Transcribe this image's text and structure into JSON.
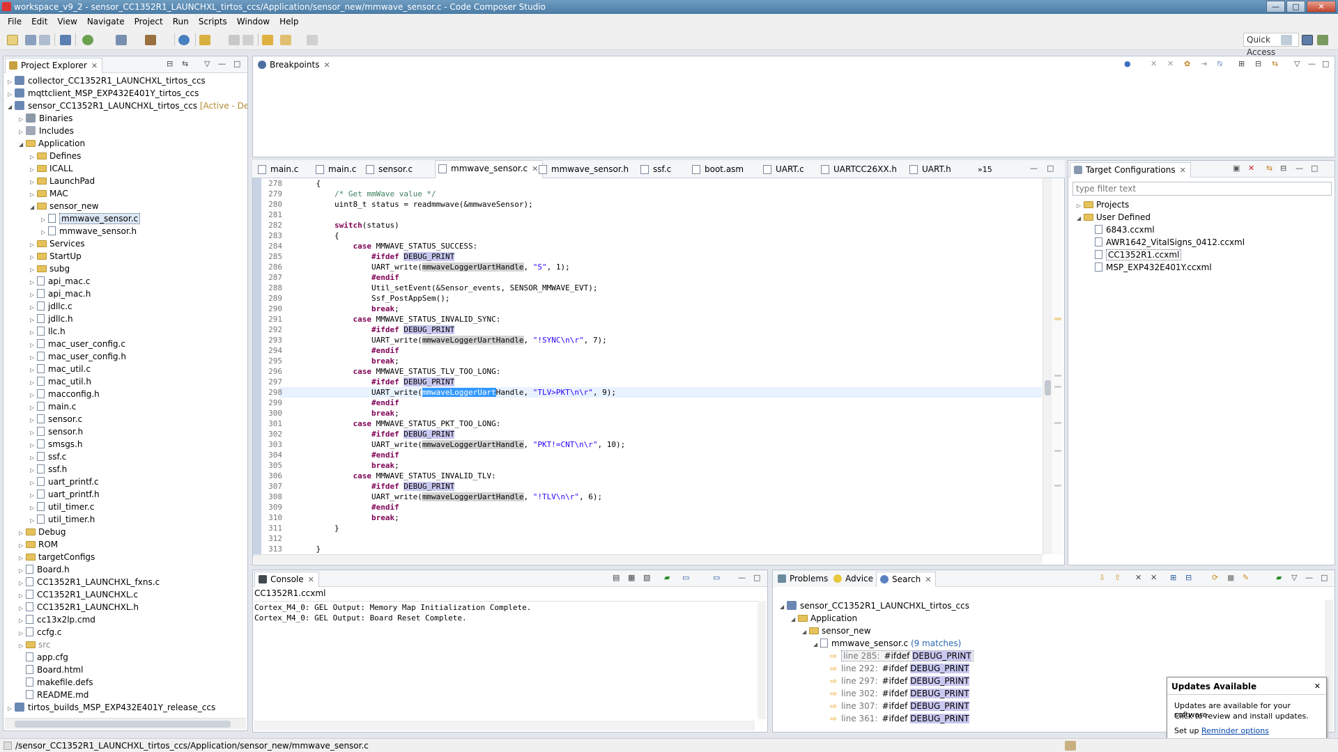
{
  "window": {
    "title": "workspace_v9_2 - sensor_CC1352R1_LAUNCHXL_tirtos_ccs/Application/sensor_new/mmwave_sensor.c - Code Composer Studio",
    "min": "—",
    "max": "□",
    "close": "✕"
  },
  "menu": [
    "File",
    "Edit",
    "View",
    "Navigate",
    "Project",
    "Run",
    "Scripts",
    "Window",
    "Help"
  ],
  "toolbar": {
    "quick_access": "Quick Access"
  },
  "project_explorer": {
    "tab": "Project Explorer",
    "items": [
      {
        "indent": 0,
        "tw": "▷",
        "icon": "proj",
        "label": "collector_CC1352R1_LAUNCHXL_tirtos_ccs"
      },
      {
        "indent": 0,
        "tw": "▷",
        "icon": "proj",
        "label": "mqttclient_MSP_EXP432E401Y_tirtos_ccs"
      },
      {
        "indent": 0,
        "tw": "◢",
        "icon": "proj",
        "label": "sensor_CC1352R1_LAUNCHXL_tirtos_ccs",
        "suffix": "[Active - Deb"
      },
      {
        "indent": 1,
        "tw": "▷",
        "icon": "bin",
        "label": "Binaries"
      },
      {
        "indent": 1,
        "tw": "▷",
        "icon": "inc",
        "label": "Includes"
      },
      {
        "indent": 1,
        "tw": "◢",
        "icon": "folder",
        "label": "Application"
      },
      {
        "indent": 2,
        "tw": "▷",
        "icon": "folder",
        "label": "Defines"
      },
      {
        "indent": 2,
        "tw": "▷",
        "icon": "folder",
        "label": "ICALL"
      },
      {
        "indent": 2,
        "tw": "▷",
        "icon": "folder",
        "label": "LaunchPad"
      },
      {
        "indent": 2,
        "tw": "▷",
        "icon": "folder",
        "label": "MAC"
      },
      {
        "indent": 2,
        "tw": "◢",
        "icon": "folder",
        "label": "sensor_new"
      },
      {
        "indent": 3,
        "tw": "▷",
        "icon": "file",
        "label": "mmwave_sensor.c",
        "selected": true
      },
      {
        "indent": 3,
        "tw": "▷",
        "icon": "file",
        "label": "mmwave_sensor.h"
      },
      {
        "indent": 2,
        "tw": "▷",
        "icon": "folder",
        "label": "Services"
      },
      {
        "indent": 2,
        "tw": "▷",
        "icon": "folder",
        "label": "StartUp"
      },
      {
        "indent": 2,
        "tw": "▷",
        "icon": "folder",
        "label": "subg"
      },
      {
        "indent": 2,
        "tw": "▷",
        "icon": "file",
        "label": "api_mac.c"
      },
      {
        "indent": 2,
        "tw": "▷",
        "icon": "file",
        "label": "api_mac.h"
      },
      {
        "indent": 2,
        "tw": "▷",
        "icon": "file",
        "label": "jdllc.c"
      },
      {
        "indent": 2,
        "tw": "▷",
        "icon": "file",
        "label": "jdllc.h"
      },
      {
        "indent": 2,
        "tw": "▷",
        "icon": "file",
        "label": "llc.h"
      },
      {
        "indent": 2,
        "tw": "▷",
        "icon": "file",
        "label": "mac_user_config.c"
      },
      {
        "indent": 2,
        "tw": "▷",
        "icon": "file",
        "label": "mac_user_config.h"
      },
      {
        "indent": 2,
        "tw": "▷",
        "icon": "file",
        "label": "mac_util.c"
      },
      {
        "indent": 2,
        "tw": "▷",
        "icon": "file",
        "label": "mac_util.h"
      },
      {
        "indent": 2,
        "tw": "▷",
        "icon": "file",
        "label": "macconfig.h"
      },
      {
        "indent": 2,
        "tw": "▷",
        "icon": "file",
        "label": "main.c"
      },
      {
        "indent": 2,
        "tw": "▷",
        "icon": "file",
        "label": "sensor.c"
      },
      {
        "indent": 2,
        "tw": "▷",
        "icon": "file",
        "label": "sensor.h"
      },
      {
        "indent": 2,
        "tw": "▷",
        "icon": "file",
        "label": "smsgs.h"
      },
      {
        "indent": 2,
        "tw": "▷",
        "icon": "file",
        "label": "ssf.c"
      },
      {
        "indent": 2,
        "tw": "▷",
        "icon": "file",
        "label": "ssf.h"
      },
      {
        "indent": 2,
        "tw": "▷",
        "icon": "file",
        "label": "uart_printf.c"
      },
      {
        "indent": 2,
        "tw": "▷",
        "icon": "file",
        "label": "uart_printf.h"
      },
      {
        "indent": 2,
        "tw": "▷",
        "icon": "file",
        "label": "util_timer.c"
      },
      {
        "indent": 2,
        "tw": "▷",
        "icon": "file",
        "label": "util_timer.h"
      },
      {
        "indent": 1,
        "tw": "▷",
        "icon": "folder",
        "label": "Debug"
      },
      {
        "indent": 1,
        "tw": "▷",
        "icon": "folder",
        "label": "ROM"
      },
      {
        "indent": 1,
        "tw": "▷",
        "icon": "folder",
        "label": "targetConfigs"
      },
      {
        "indent": 1,
        "tw": "▷",
        "icon": "file",
        "label": "Board.h"
      },
      {
        "indent": 1,
        "tw": "▷",
        "icon": "file",
        "label": "CC1352R1_LAUNCHXL_fxns.c"
      },
      {
        "indent": 1,
        "tw": "▷",
        "icon": "file",
        "label": "CC1352R1_LAUNCHXL.c"
      },
      {
        "indent": 1,
        "tw": "▷",
        "icon": "file",
        "label": "CC1352R1_LAUNCHXL.h"
      },
      {
        "indent": 1,
        "tw": "▷",
        "icon": "file",
        "label": "cc13x2lp.cmd"
      },
      {
        "indent": 1,
        "tw": "▷",
        "icon": "file",
        "label": "ccfg.c"
      },
      {
        "indent": 1,
        "tw": "▷",
        "icon": "folder",
        "label": "src",
        "grey": true
      },
      {
        "indent": 1,
        "tw": "",
        "icon": "file",
        "label": "app.cfg"
      },
      {
        "indent": 1,
        "tw": "",
        "icon": "file",
        "label": "Board.html"
      },
      {
        "indent": 1,
        "tw": "",
        "icon": "file",
        "label": "makefile.defs"
      },
      {
        "indent": 1,
        "tw": "",
        "icon": "file",
        "label": "README.md"
      },
      {
        "indent": 0,
        "tw": "▷",
        "icon": "proj",
        "label": "tirtos_builds_MSP_EXP432E401Y_release_ccs"
      }
    ]
  },
  "breakpoints": {
    "tab": "Breakpoints"
  },
  "editor": {
    "tabs": [
      {
        "label": "main.c"
      },
      {
        "label": "main.c"
      },
      {
        "label": "sensor.c"
      },
      {
        "label": "mmwave_sensor.c",
        "active": true
      },
      {
        "label": "mmwave_sensor.h"
      },
      {
        "label": "ssf.c"
      },
      {
        "label": "boot.asm"
      },
      {
        "label": "UART.c"
      },
      {
        "label": "UARTCC26XX.h"
      },
      {
        "label": "UART.h"
      }
    ],
    "overflow": "»15",
    "lines": [
      {
        "n": "278",
        "t": [
          [
            "    {",
            ""
          ]
        ]
      },
      {
        "n": "279",
        "t": [
          [
            "        ",
            ""
          ],
          [
            "/* Get mmWave value */",
            "cm"
          ]
        ]
      },
      {
        "n": "280",
        "t": [
          [
            "        uint8_t status = readmmwave(&mmwaveSensor);",
            ""
          ]
        ]
      },
      {
        "n": "281",
        "t": []
      },
      {
        "n": "282",
        "t": [
          [
            "        ",
            ""
          ],
          [
            "switch",
            "kw"
          ],
          [
            "(status)",
            ""
          ]
        ]
      },
      {
        "n": "283",
        "t": [
          [
            "        {",
            ""
          ]
        ]
      },
      {
        "n": "284",
        "t": [
          [
            "            ",
            ""
          ],
          [
            "case",
            "kw"
          ],
          [
            " MMWAVE_STATUS_SUCCESS:",
            ""
          ]
        ]
      },
      {
        "n": "285",
        "m": true,
        "t": [
          [
            "                ",
            ""
          ],
          [
            "#ifdef",
            "kw"
          ],
          [
            " ",
            ""
          ],
          [
            "DEBUG_PRINT",
            "dp"
          ]
        ]
      },
      {
        "n": "286",
        "t": [
          [
            "                UART_write(",
            ""
          ],
          [
            "mmwaveLoggerUartHandle",
            "hl"
          ],
          [
            ", ",
            ""
          ],
          [
            "\"S\"",
            "st"
          ],
          [
            ", 1);",
            ""
          ]
        ]
      },
      {
        "n": "287",
        "t": [
          [
            "                ",
            ""
          ],
          [
            "#endif",
            "kw"
          ]
        ]
      },
      {
        "n": "288",
        "t": [
          [
            "                Util_setEvent(&Sensor_events, SENSOR_MMWAVE_EVT);",
            ""
          ]
        ]
      },
      {
        "n": "289",
        "t": [
          [
            "                Ssf_PostAppSem();",
            ""
          ]
        ]
      },
      {
        "n": "290",
        "t": [
          [
            "                ",
            ""
          ],
          [
            "break",
            "kw"
          ],
          [
            ";",
            ""
          ]
        ]
      },
      {
        "n": "291",
        "t": [
          [
            "            ",
            ""
          ],
          [
            "case",
            "kw"
          ],
          [
            " MMWAVE_STATUS_INVALID_SYNC:",
            ""
          ]
        ]
      },
      {
        "n": "292",
        "m": true,
        "t": [
          [
            "                ",
            ""
          ],
          [
            "#ifdef",
            "kw"
          ],
          [
            " ",
            ""
          ],
          [
            "DEBUG_PRINT",
            "dp"
          ]
        ]
      },
      {
        "n": "293",
        "t": [
          [
            "                UART_write(",
            ""
          ],
          [
            "mmwaveLoggerUartHandle",
            "hl"
          ],
          [
            ", ",
            ""
          ],
          [
            "\"!SYNC\\n\\r\"",
            "st"
          ],
          [
            ", 7);",
            ""
          ]
        ]
      },
      {
        "n": "294",
        "t": [
          [
            "                ",
            ""
          ],
          [
            "#endif",
            "kw"
          ]
        ]
      },
      {
        "n": "295",
        "t": [
          [
            "                ",
            ""
          ],
          [
            "break",
            "kw"
          ],
          [
            ";",
            ""
          ]
        ]
      },
      {
        "n": "296",
        "t": [
          [
            "            ",
            ""
          ],
          [
            "case",
            "kw"
          ],
          [
            " MMWAVE_STATUS_TLV_TOO_LONG:",
            ""
          ]
        ]
      },
      {
        "n": "297",
        "m": true,
        "t": [
          [
            "                ",
            ""
          ],
          [
            "#ifdef",
            "kw"
          ],
          [
            " ",
            ""
          ],
          [
            "DEBUG_PRINT",
            "dp"
          ]
        ]
      },
      {
        "n": "298",
        "cur": true,
        "t": [
          [
            "                UART_write(",
            ""
          ],
          [
            "mmwaveLoggerUart",
            "sel"
          ],
          [
            "Handle",
            ""
          ],
          [
            ", ",
            ""
          ],
          [
            "\"TLV>PKT\\n\\r\"",
            "st"
          ],
          [
            ", 9);",
            ""
          ]
        ]
      },
      {
        "n": "299",
        "t": [
          [
            "                ",
            ""
          ],
          [
            "#endif",
            "kw"
          ]
        ]
      },
      {
        "n": "300",
        "t": [
          [
            "                ",
            ""
          ],
          [
            "break",
            "kw"
          ],
          [
            ";",
            ""
          ]
        ]
      },
      {
        "n": "301",
        "t": [
          [
            "            ",
            ""
          ],
          [
            "case",
            "kw"
          ],
          [
            " MMWAVE_STATUS_PKT_TOO_LONG:",
            ""
          ]
        ]
      },
      {
        "n": "302",
        "m": true,
        "t": [
          [
            "                ",
            ""
          ],
          [
            "#ifdef",
            "kw"
          ],
          [
            " ",
            ""
          ],
          [
            "DEBUG_PRINT",
            "dp"
          ]
        ]
      },
      {
        "n": "303",
        "t": [
          [
            "                UART_write(",
            ""
          ],
          [
            "mmwaveLoggerUartHandle",
            "hl"
          ],
          [
            ", ",
            ""
          ],
          [
            "\"PKT!=CNT\\n\\r\"",
            "st"
          ],
          [
            ", 10);",
            ""
          ]
        ]
      },
      {
        "n": "304",
        "t": [
          [
            "                ",
            ""
          ],
          [
            "#endif",
            "kw"
          ]
        ]
      },
      {
        "n": "305",
        "t": [
          [
            "                ",
            ""
          ],
          [
            "break",
            "kw"
          ],
          [
            ";",
            ""
          ]
        ]
      },
      {
        "n": "306",
        "t": [
          [
            "            ",
            ""
          ],
          [
            "case",
            "kw"
          ],
          [
            " MMWAVE_STATUS_INVALID_TLV:",
            ""
          ]
        ]
      },
      {
        "n": "307",
        "m": true,
        "t": [
          [
            "                ",
            ""
          ],
          [
            "#ifdef",
            "kw"
          ],
          [
            " ",
            ""
          ],
          [
            "DEBUG_PRINT",
            "dp"
          ]
        ]
      },
      {
        "n": "308",
        "t": [
          [
            "                UART_write(",
            ""
          ],
          [
            "mmwaveLoggerUartHandle",
            "hl"
          ],
          [
            ", ",
            ""
          ],
          [
            "\"!TLV\\n\\r\"",
            "st"
          ],
          [
            ", 6);",
            ""
          ]
        ]
      },
      {
        "n": "309",
        "t": [
          [
            "                ",
            ""
          ],
          [
            "#endif",
            "kw"
          ]
        ]
      },
      {
        "n": "310",
        "t": [
          [
            "                ",
            ""
          ],
          [
            "break",
            "kw"
          ],
          [
            ";",
            ""
          ]
        ]
      },
      {
        "n": "311",
        "t": [
          [
            "        }",
            ""
          ]
        ]
      },
      {
        "n": "312",
        "t": []
      },
      {
        "n": "313",
        "t": [
          [
            "    }",
            ""
          ]
        ]
      }
    ]
  },
  "target_configs": {
    "tab": "Target Configurations",
    "filter_placeholder": "type filter text",
    "items": [
      {
        "indent": 0,
        "tw": "▷",
        "icon": "folder",
        "label": "Projects"
      },
      {
        "indent": 0,
        "tw": "◢",
        "icon": "folder",
        "label": "User Defined"
      },
      {
        "indent": 1,
        "tw": "",
        "icon": "file",
        "label": "6843.ccxml"
      },
      {
        "indent": 1,
        "tw": "",
        "icon": "file",
        "label": "AWR1642_VitalSigns_0412.ccxml"
      },
      {
        "indent": 1,
        "tw": "",
        "icon": "file",
        "label": "CC1352R1.ccxml",
        "selected": true
      },
      {
        "indent": 1,
        "tw": "",
        "icon": "file",
        "label": "MSP_EXP432E401Y.ccxml"
      }
    ]
  },
  "console": {
    "tab": "Console",
    "title": "CC1352R1.ccxml",
    "lines": [
      "Cortex_M4_0: GEL Output: Memory Map Initialization Complete.",
      "Cortex_M4_0: GEL Output: Board Reset Complete."
    ]
  },
  "bottom_right": {
    "tabs": [
      "Problems",
      "Advice",
      "Search"
    ],
    "tree": [
      {
        "indent": 0,
        "tw": "◢",
        "icon": "proj",
        "label": "sensor_CC1352R1_LAUNCHXL_tirtos_ccs"
      },
      {
        "indent": 1,
        "tw": "◢",
        "icon": "folder",
        "label": "Application"
      },
      {
        "indent": 2,
        "tw": "◢",
        "icon": "folder",
        "label": "sensor_new"
      },
      {
        "indent": 3,
        "tw": "◢",
        "icon": "file",
        "label": "mmwave_sensor.c",
        "matches": "(9 matches)"
      }
    ],
    "results": [
      {
        "line": "line 285:",
        "pre": "#ifdef ",
        "match": "DEBUG_PRINT",
        "first": true
      },
      {
        "line": "line 292:",
        "pre": "#ifdef ",
        "match": "DEBUG_PRINT"
      },
      {
        "line": "line 297:",
        "pre": "#ifdef ",
        "match": "DEBUG_PRINT"
      },
      {
        "line": "line 302:",
        "pre": "#ifdef ",
        "match": "DEBUG_PRINT"
      },
      {
        "line": "line 307:",
        "pre": "#ifdef ",
        "match": "DEBUG_PRINT"
      },
      {
        "line": "line 361:",
        "pre": "#ifdef ",
        "match": "DEBUG_PRINT"
      }
    ]
  },
  "popup": {
    "title": "Updates Available",
    "close": "✕",
    "body1": "Updates are available for your software.",
    "body2": "Click to review and install updates.",
    "setup_prefix": "Set up",
    "setup_link": "Reminder options"
  },
  "statusbar": {
    "path": "/sensor_CC1352R1_LAUNCHXL_tirtos_ccs/Application/sensor_new/mmwave_sensor.c"
  },
  "colors": {
    "keyword": "#7f0055",
    "comment": "#3f7f5f",
    "string": "#2a00ff",
    "link": "#0645ad"
  }
}
